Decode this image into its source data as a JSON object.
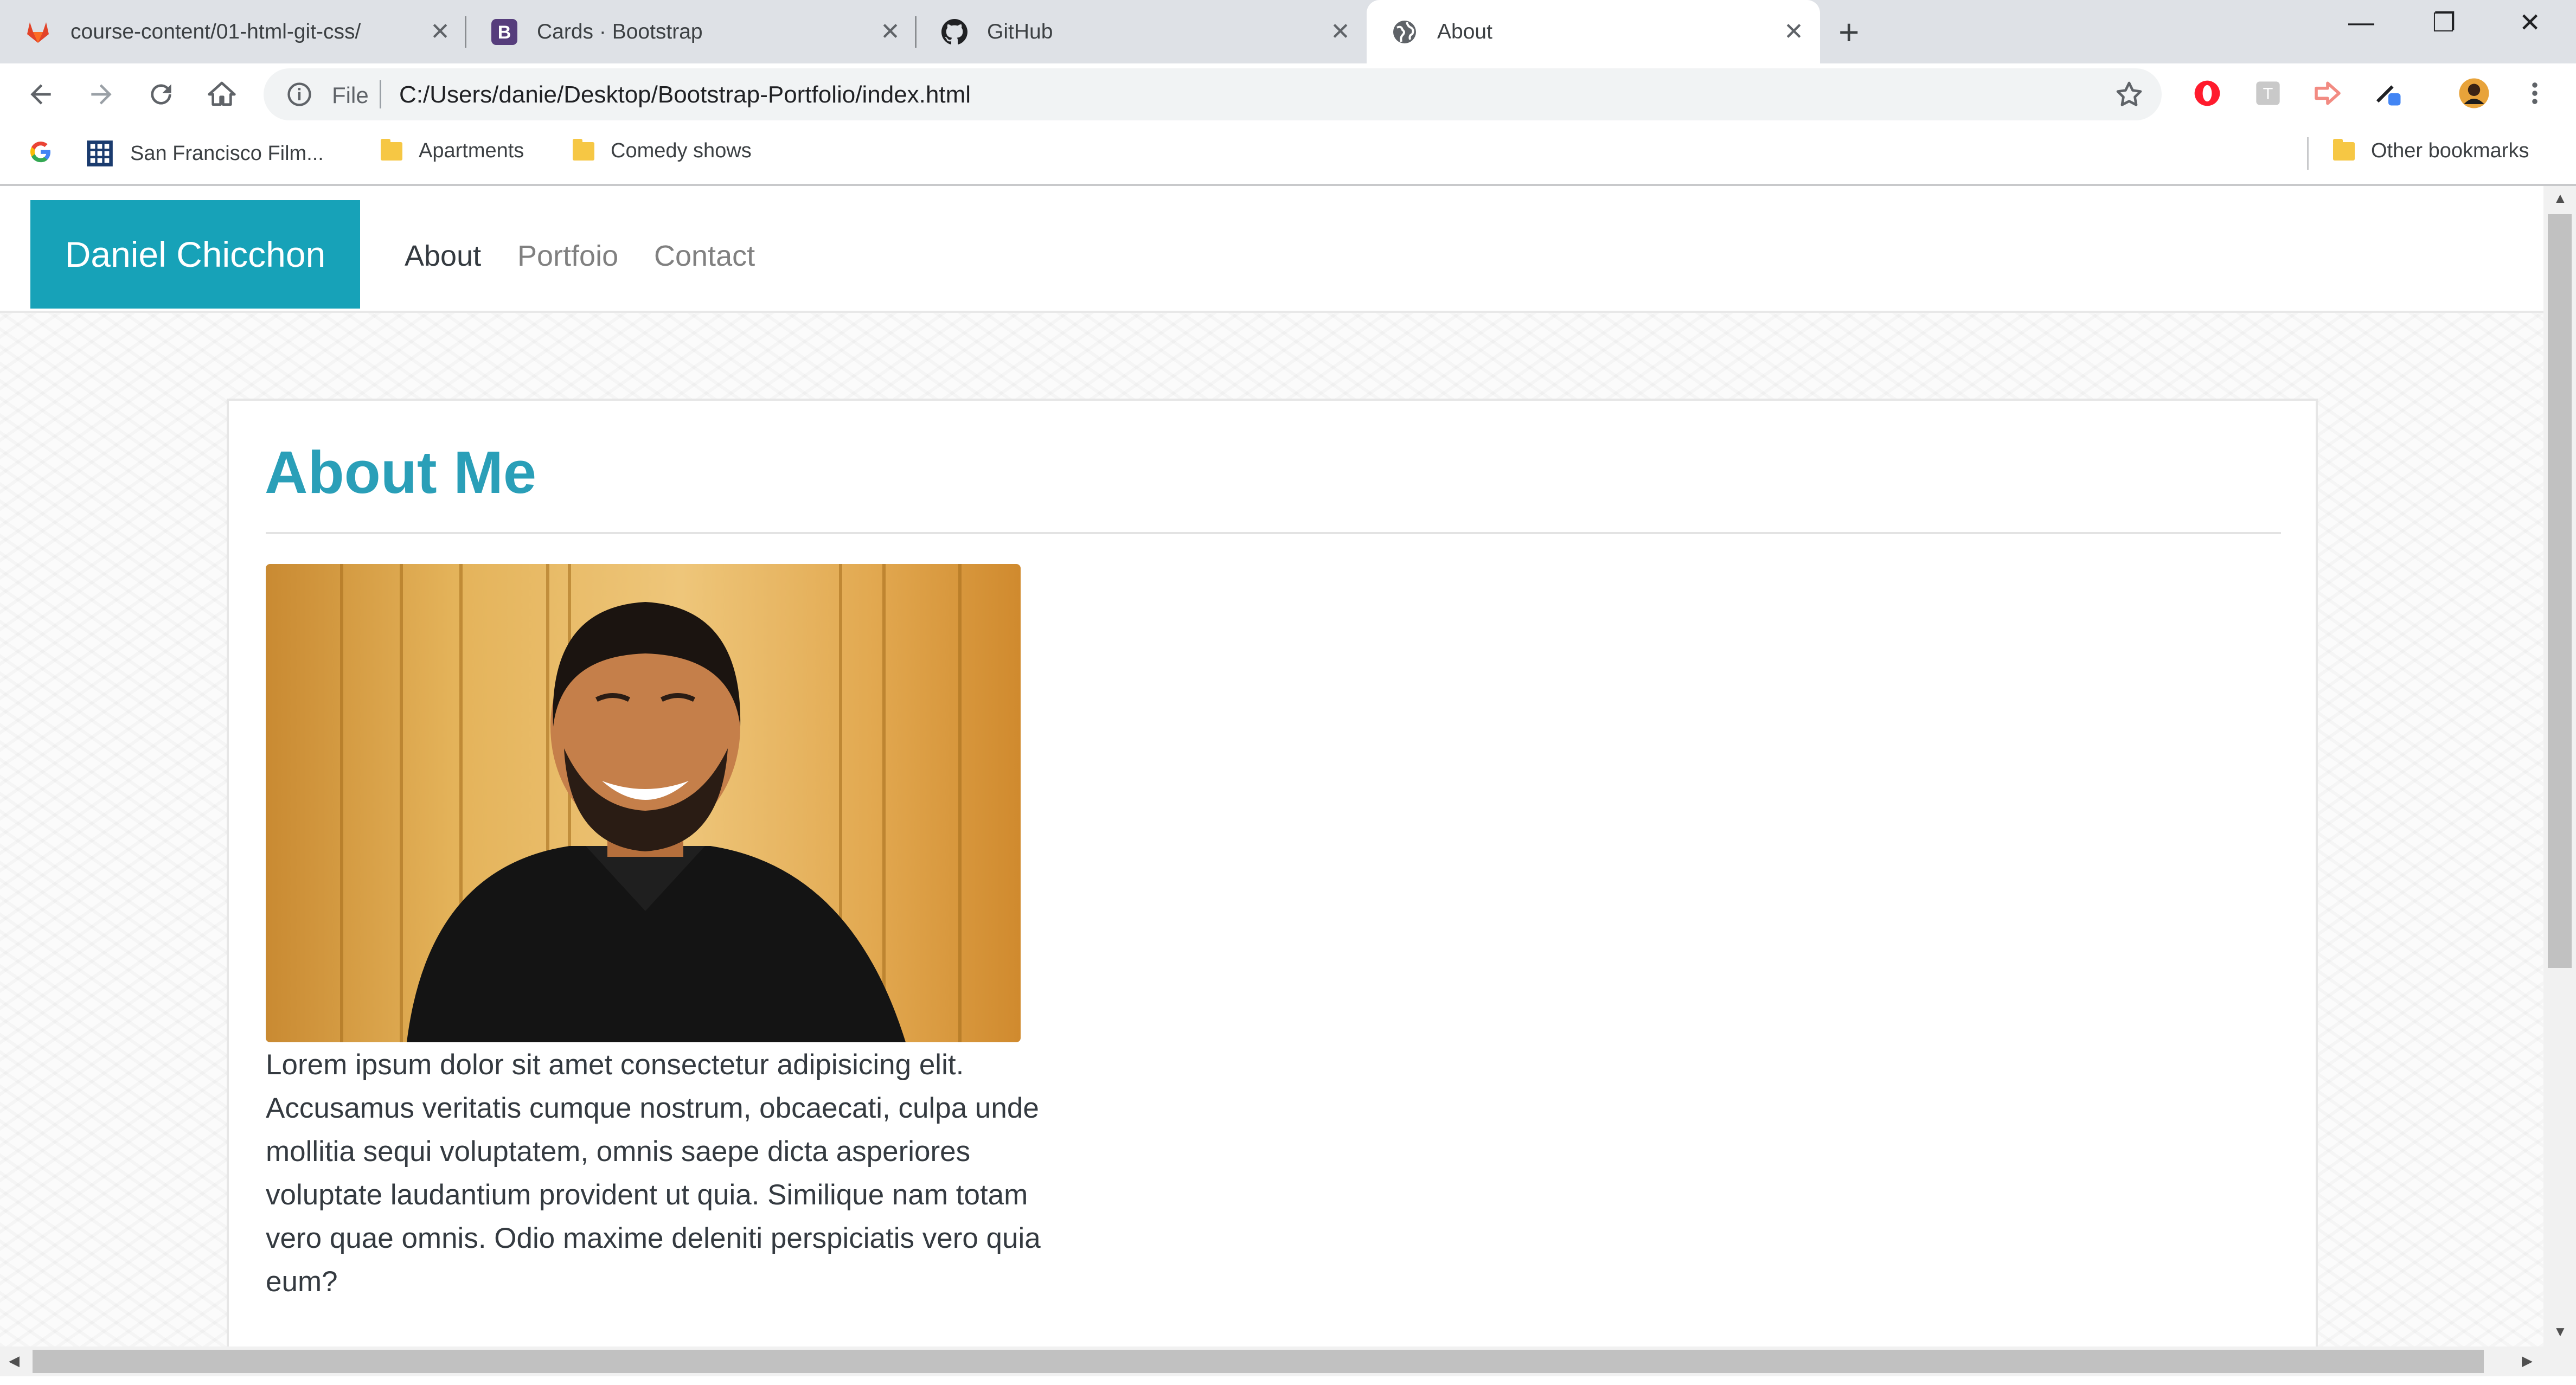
{
  "browser": {
    "tabs": [
      {
        "title": "course-content/01-html-git-css/",
        "icon": "gitlab-icon",
        "active": false
      },
      {
        "title": "Cards · Bootstrap",
        "icon": "bootstrap-icon",
        "active": false
      },
      {
        "title": "GitHub",
        "icon": "github-icon",
        "active": false
      },
      {
        "title": "About",
        "icon": "globe-icon",
        "active": true
      }
    ],
    "close_glyph": "✕",
    "new_tab_glyph": "+",
    "window_controls": {
      "minimize": "—",
      "restore": "❐",
      "close": "✕"
    },
    "address": {
      "scheme_label": "File",
      "url": "C:/Users/danie/Desktop/Bootstrap-Portfolio/index.html"
    },
    "bookmarks": [
      {
        "label": "San Francisco Film...",
        "icon": "apps-grid-icon"
      },
      {
        "label": "Apartments",
        "icon": "folder-icon"
      },
      {
        "label": "Comedy shows",
        "icon": "folder-icon"
      }
    ],
    "other_bookmarks": "Other bookmarks"
  },
  "site": {
    "brand": "Daniel Chicchon",
    "nav": [
      {
        "label": "About",
        "active": true
      },
      {
        "label": "Portfoio",
        "active": false
      },
      {
        "label": "Contact",
        "active": false
      }
    ]
  },
  "about": {
    "title": "About Me",
    "bio": "Lorem ipsum dolor sit amet consectetur adipisicing elit. Accusamus veritatis cumque nostrum, obcaecati, culpa unde mollitia sequi voluptatem, omnis saepe dicta asperiores voluptate laudantium provident ut quia. Similique nam totam vero quae omnis. Odio maxime deleniti perspiciatis vero quia eum?"
  },
  "colors": {
    "brand": "#17a2b8",
    "heading": "#2a9fb8",
    "nav_active": "#343a40",
    "nav_inactive": "#808080"
  }
}
